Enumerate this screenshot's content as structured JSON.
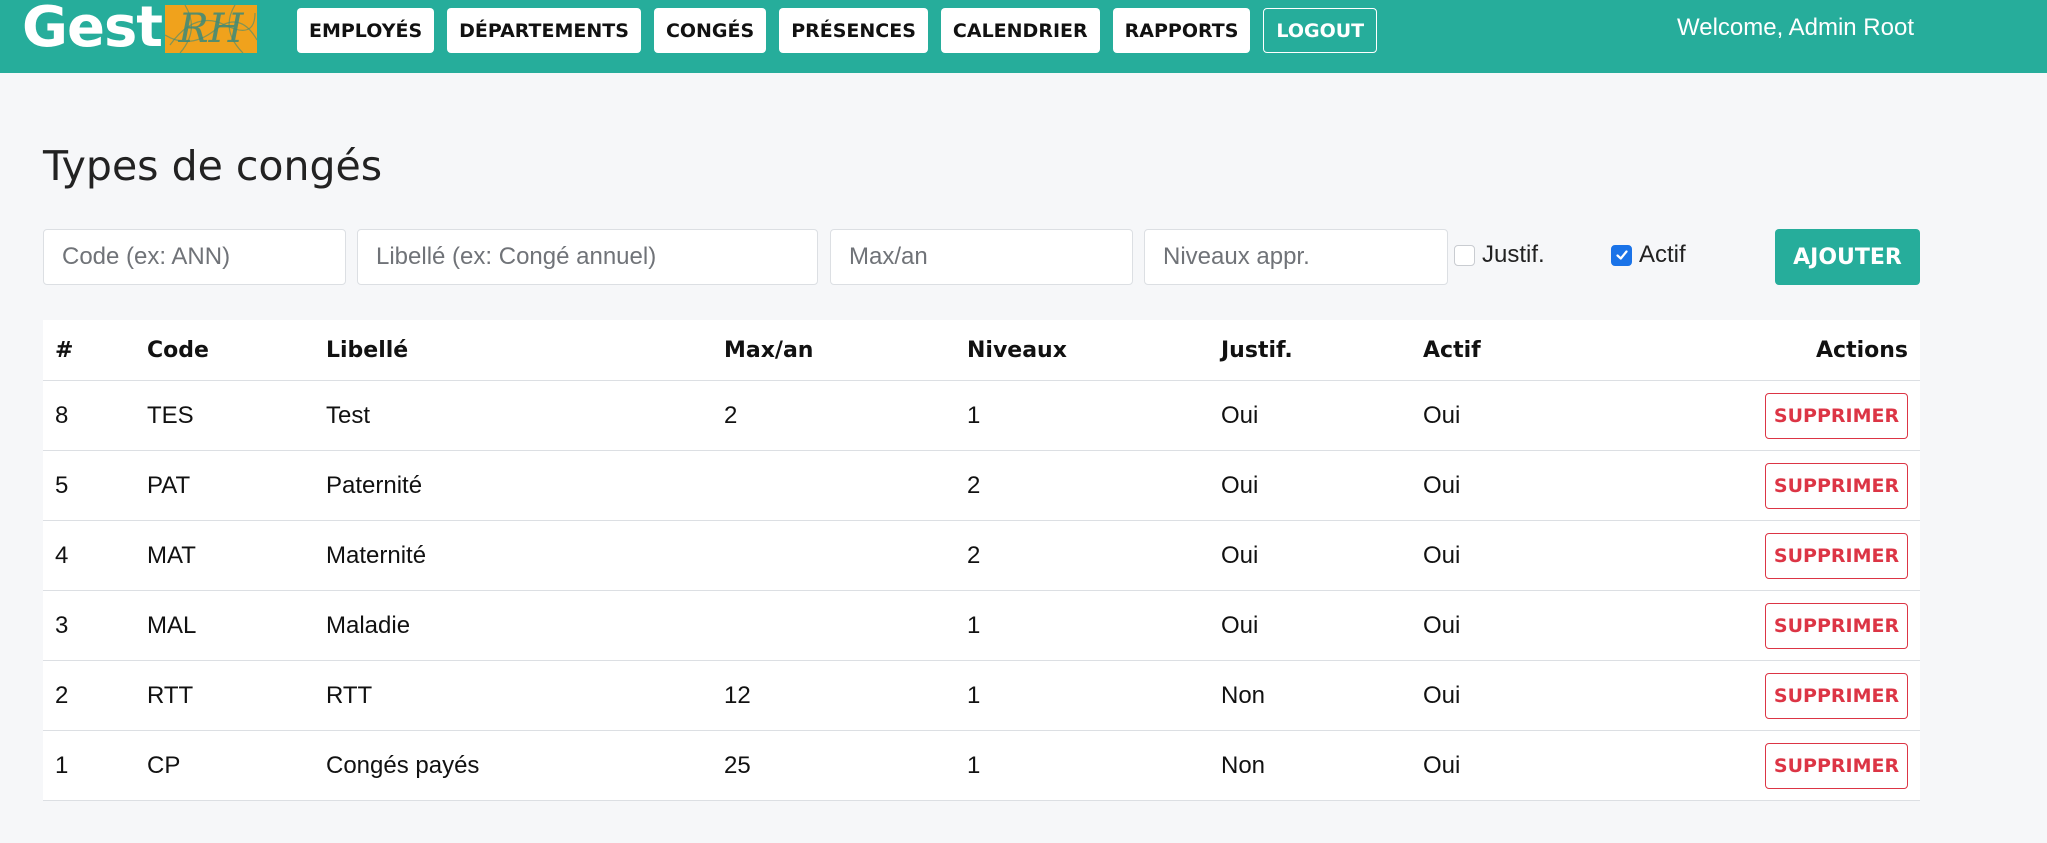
{
  "brand": {
    "name": "Gest",
    "badge": "RH"
  },
  "nav": [
    {
      "label": "EMPLOYÉS"
    },
    {
      "label": "DÉPARTEMENTS"
    },
    {
      "label": "CONGÉS"
    },
    {
      "label": "PRÉSENCES"
    },
    {
      "label": "CALENDRIER"
    },
    {
      "label": "RAPPORTS"
    }
  ],
  "logout_label": "LOGOUT",
  "welcome": "Welcome, Admin Root",
  "page_title": "Types de congés",
  "form": {
    "code_placeholder": "Code (ex: ANN)",
    "libelle_placeholder": "Libellé (ex: Congé annuel)",
    "max_placeholder": "Max/an",
    "niveaux_placeholder": "Niveaux appr.",
    "justif_label": "Justif.",
    "justif_checked": false,
    "actif_label": "Actif",
    "actif_checked": true,
    "add_label": "AJOUTER"
  },
  "table": {
    "headers": [
      "#",
      "Code",
      "Libellé",
      "Max/an",
      "Niveaux",
      "Justif.",
      "Actif",
      "Actions"
    ],
    "delete_label": "SUPPRIMER",
    "rows": [
      {
        "id": "8",
        "code": "TES",
        "libelle": "Test",
        "max": "2",
        "niveaux": "1",
        "justif": "Oui",
        "actif": "Oui"
      },
      {
        "id": "5",
        "code": "PAT",
        "libelle": "Paternité",
        "max": "",
        "niveaux": "2",
        "justif": "Oui",
        "actif": "Oui"
      },
      {
        "id": "4",
        "code": "MAT",
        "libelle": "Maternité",
        "max": "",
        "niveaux": "2",
        "justif": "Oui",
        "actif": "Oui"
      },
      {
        "id": "3",
        "code": "MAL",
        "libelle": "Maladie",
        "max": "",
        "niveaux": "1",
        "justif": "Oui",
        "actif": "Oui"
      },
      {
        "id": "2",
        "code": "RTT",
        "libelle": "RTT",
        "max": "12",
        "niveaux": "1",
        "justif": "Non",
        "actif": "Oui"
      },
      {
        "id": "1",
        "code": "CP",
        "libelle": "Congés payés",
        "max": "25",
        "niveaux": "1",
        "justif": "Non",
        "actif": "Oui"
      }
    ]
  }
}
